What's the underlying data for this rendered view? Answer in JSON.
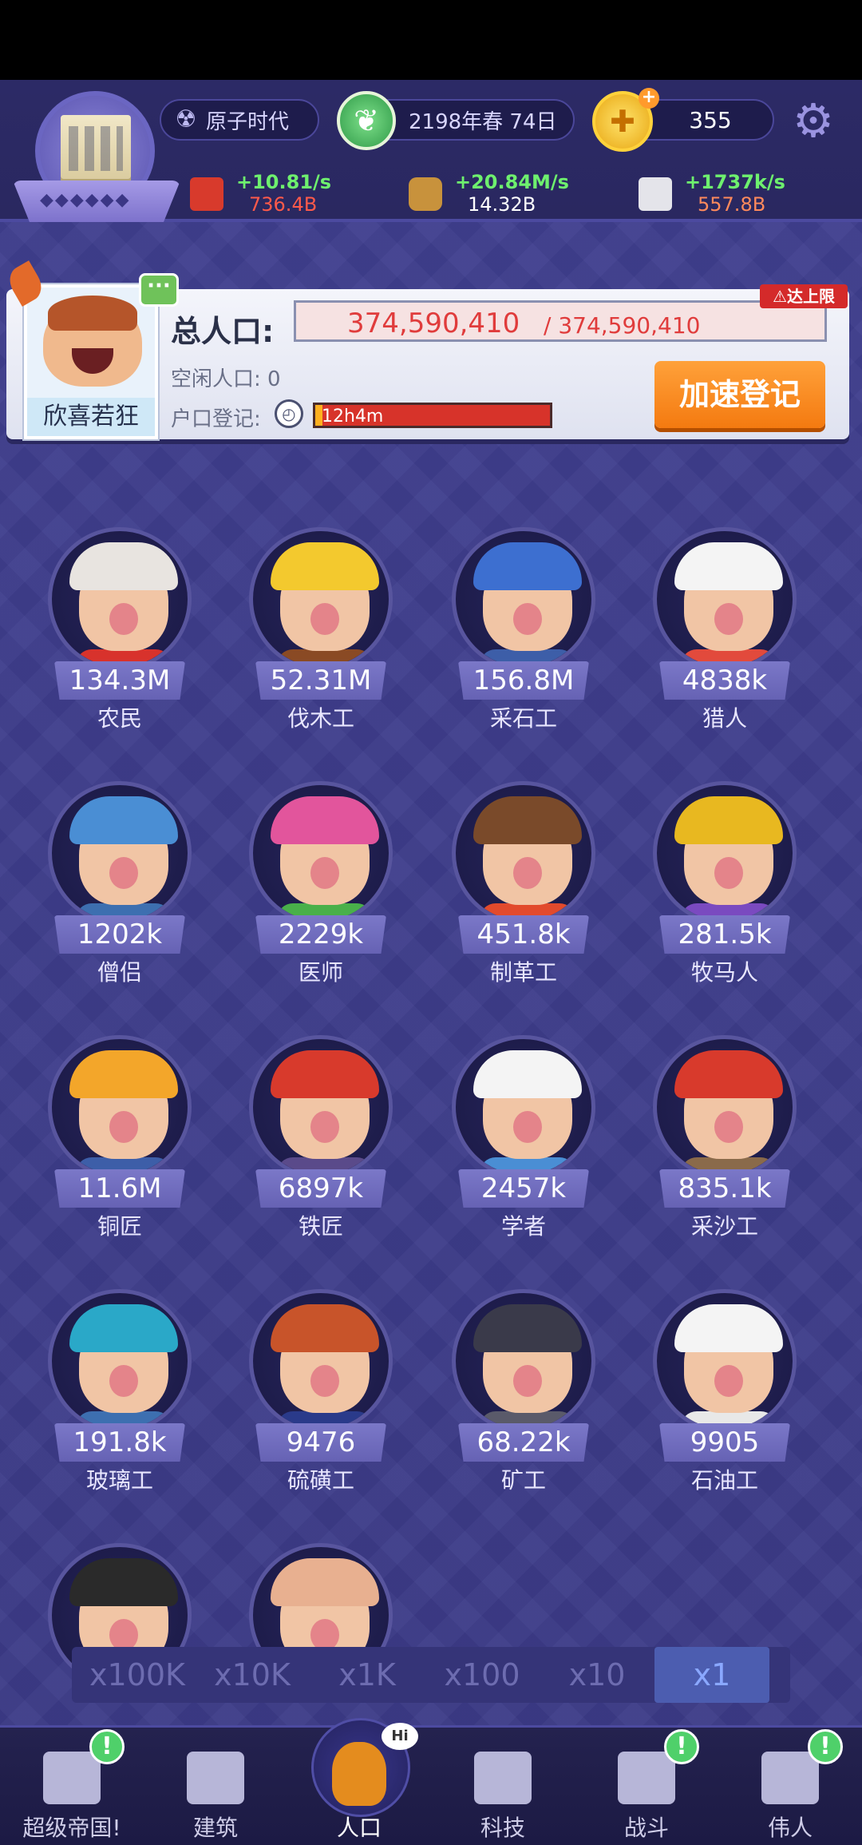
{
  "header": {
    "era": "原子时代",
    "date": "2198年春 74日",
    "coins": "355",
    "resources": [
      {
        "icon": "red-cube-icon",
        "rate": "+10.81/s",
        "total": "736.4B"
      },
      {
        "icon": "wood-logs-icon",
        "rate": "+20.84M/s",
        "total": "14.32B"
      },
      {
        "icon": "stone-cube-icon",
        "rate": "+1737k/s",
        "total": "557.8B"
      }
    ]
  },
  "population": {
    "label": "总人口:",
    "current": "374,590,410",
    "max": "/ 374,590,410",
    "limit_badge": "⚠达上限",
    "idle": "空闲人口: 0",
    "registration_label": "户口登记:",
    "registration_time": "12h4m",
    "registration_progress": 0.03,
    "speed_button": "加速登记",
    "mood": "欣喜若狂"
  },
  "workers": [
    {
      "count": "134.3M",
      "name": "农民",
      "hair": "#e8e4e0",
      "body": "#d8322c"
    },
    {
      "count": "52.31M",
      "name": "伐木工",
      "hair": "#f3c92e",
      "body": "#8a4a24"
    },
    {
      "count": "156.8M",
      "name": "采石工",
      "hair": "#3d6fd0",
      "body": "#3d5ea8"
    },
    {
      "count": "4838k",
      "name": "猎人",
      "hair": "#f4f4f4",
      "body": "#e24a3c"
    },
    {
      "count": "1202k",
      "name": "僧侣",
      "hair": "#4a8ed4",
      "body": "#3d6fb0"
    },
    {
      "count": "2229k",
      "name": "医师",
      "hair": "#e2559c",
      "body": "#49b04a"
    },
    {
      "count": "451.8k",
      "name": "制革工",
      "hair": "#7a4a2a",
      "body": "#e24a2c"
    },
    {
      "count": "281.5k",
      "name": "牧马人",
      "hair": "#e8b820",
      "body": "#7a4ac0"
    },
    {
      "count": "11.6M",
      "name": "铜匠",
      "hair": "#f3a62a",
      "body": "#3d5ea8"
    },
    {
      "count": "6897k",
      "name": "铁匠",
      "hair": "#d83a2c",
      "body": "#5a4a8a"
    },
    {
      "count": "2457k",
      "name": "学者",
      "hair": "#f4f4f4",
      "body": "#4a8ed4"
    },
    {
      "count": "835.1k",
      "name": "采沙工",
      "hair": "#d83a2c",
      "body": "#8a6a4a"
    },
    {
      "count": "191.8k",
      "name": "玻璃工",
      "hair": "#2aa8c8",
      "body": "#3d6fb0"
    },
    {
      "count": "9476",
      "name": "硫磺工",
      "hair": "#c8542a",
      "body": "#2a3a8a"
    },
    {
      "count": "68.22k",
      "name": "矿工",
      "hair": "#3a3a4a",
      "body": "#5a5a6a"
    },
    {
      "count": "9905",
      "name": "石油工",
      "hair": "#f4f4f4",
      "body": "#e8e8e8"
    },
    {
      "count": "",
      "name": "",
      "hair": "#2a2a2a",
      "body": "#6a6aa0"
    },
    {
      "count": "",
      "name": "",
      "hair": "#e8b090",
      "body": "#c02a2a"
    }
  ],
  "multipliers": [
    "x100K",
    "x10K",
    "x1K",
    "x100",
    "x10",
    "x1"
  ],
  "active_multiplier": "x1",
  "nav": [
    {
      "label": "超级帝国!",
      "icon": "castle-icon",
      "alert": true
    },
    {
      "label": "建筑",
      "icon": "house-icon",
      "alert": false
    },
    {
      "label": "人口",
      "icon": "person-icon",
      "alert": false,
      "active": true,
      "bubble": "Hi"
    },
    {
      "label": "科技",
      "icon": "book-icon",
      "alert": false
    },
    {
      "label": "战斗",
      "icon": "swords-icon",
      "alert": true
    },
    {
      "label": "伟人",
      "icon": "statue-icon",
      "alert": true
    }
  ],
  "alert_symbol": "!"
}
